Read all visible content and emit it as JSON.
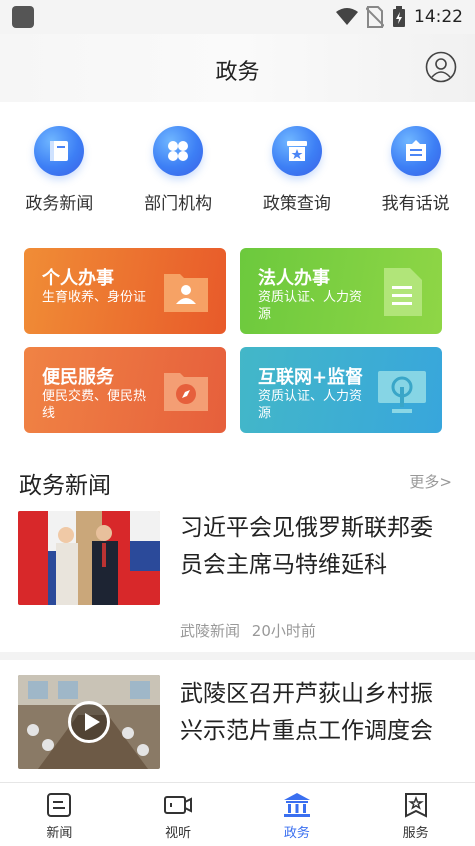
{
  "status_bar": {
    "time": "14:22"
  },
  "header": {
    "title": "政务"
  },
  "shortcuts": [
    {
      "label": "政务新闻",
      "icon": "book-icon"
    },
    {
      "label": "部门机构",
      "icon": "grid-icon"
    },
    {
      "label": "政策查询",
      "icon": "star-archive-icon"
    },
    {
      "label": "我有话说",
      "icon": "message-icon"
    }
  ],
  "cards": [
    {
      "title": "个人办事",
      "subtitle": "生育收养、身份证",
      "icon": "id-card-icon"
    },
    {
      "title": "法人办事",
      "subtitle": "资质认证、人力资源",
      "icon": "document-icon"
    },
    {
      "title": "便民服务",
      "subtitle": "便民交费、便民热线",
      "icon": "folder-compass-icon"
    },
    {
      "title": "互联网+监督",
      "subtitle": "资质认证、人力资源",
      "icon": "monitor-icon"
    }
  ],
  "news_section": {
    "title": "政务新闻",
    "more": "更多>",
    "items": [
      {
        "title": "习近平会见俄罗斯联邦委员会主席马特维延科",
        "source": "武陵新闻",
        "time": "20小时前",
        "has_video": false
      },
      {
        "title": "武陵区召开芦荻山乡村振兴示范片重点工作调度会",
        "source": "",
        "time": "",
        "has_video": true
      }
    ]
  },
  "bottom_nav": [
    {
      "label": "新闻",
      "icon": "news-icon",
      "active": false
    },
    {
      "label": "视听",
      "icon": "video-camera-icon",
      "active": false
    },
    {
      "label": "政务",
      "icon": "government-building-icon",
      "active": true
    },
    {
      "label": "服务",
      "icon": "service-star-icon",
      "active": false
    }
  ],
  "colors": {
    "accent": "#3a6ff0",
    "card1": "#e85a2a",
    "card2": "#6cc93d",
    "card3": "#e65f3c",
    "card4": "#38a6dc"
  }
}
